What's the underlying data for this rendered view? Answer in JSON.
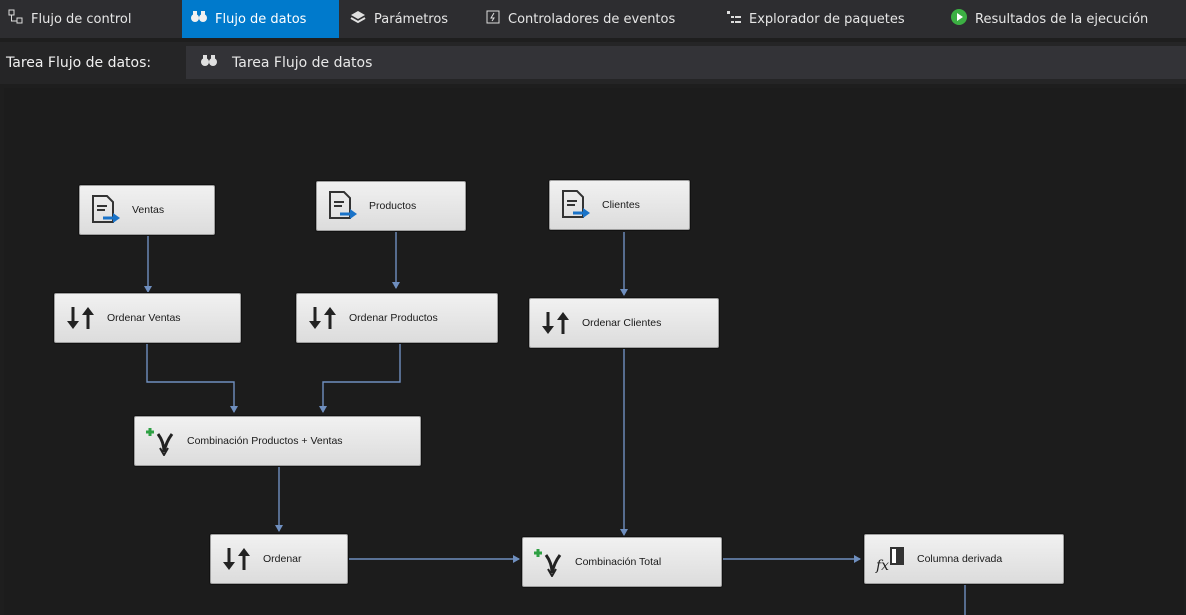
{
  "tabs": [
    {
      "label": "Flujo de control",
      "icon": "control-flow-icon"
    },
    {
      "label": "Flujo de datos",
      "icon": "data-flow-icon",
      "active": true
    },
    {
      "label": "Parámetros",
      "icon": "parameters-icon"
    },
    {
      "label": "Controladores de eventos",
      "icon": "event-handlers-icon"
    },
    {
      "label": "Explorador de paquetes",
      "icon": "package-explorer-icon"
    },
    {
      "label": "Resultados de la ejecución",
      "icon": "play-icon"
    }
  ],
  "taskbar": {
    "label": "Tarea Flujo de datos:",
    "selected_task": "Tarea Flujo de datos"
  },
  "nodes": {
    "ventas": {
      "label": "Ventas",
      "icon": "flat-file-source-icon"
    },
    "productos": {
      "label": "Productos",
      "icon": "flat-file-source-icon"
    },
    "clientes": {
      "label": "Clientes",
      "icon": "flat-file-source-icon"
    },
    "ordenar_ventas": {
      "label": "Ordenar Ventas",
      "icon": "sort-icon"
    },
    "ordenar_productos": {
      "label": "Ordenar Productos",
      "icon": "sort-icon"
    },
    "ordenar_clientes": {
      "label": "Ordenar Clientes",
      "icon": "sort-icon"
    },
    "combinacion_pv": {
      "label": "Combinación Productos + Ventas",
      "icon": "merge-join-icon"
    },
    "ordenar": {
      "label": "Ordenar",
      "icon": "sort-icon"
    },
    "combinacion_total": {
      "label": "Combinación Total",
      "icon": "merge-join-icon"
    },
    "columna_derivada": {
      "label": "Columna derivada",
      "icon": "derived-column-icon"
    }
  },
  "colors": {
    "accent": "#007acc",
    "connector": "#6f8fbf",
    "canvas": "#1c1c1c"
  }
}
